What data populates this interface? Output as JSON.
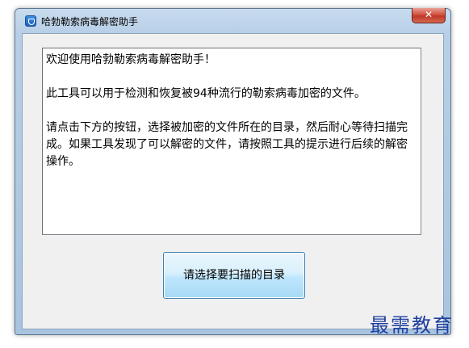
{
  "window": {
    "title": "哈勃勒索病毒解密助手",
    "close_symbol": "✕"
  },
  "message": {
    "line1": "欢迎使用哈勃勒索病毒解密助手！",
    "line2": "此工具可以用于检测和恢复被94种流行的勒索病毒加密的文件。",
    "line3": "请点击下方的按钮，选择被加密的文件所在的目录，然后耐心等待扫描完成。如果工具发现了可以解密的文件，请按照工具的提示进行后续的解密操作。"
  },
  "actions": {
    "scan_button_label": "请选择要扫描的目录"
  },
  "watermark": {
    "text": "最需教育"
  },
  "icons": {
    "app": "shield-app-icon",
    "close": "close-icon"
  },
  "colors": {
    "titlebar": "#b7cfe7",
    "close_button": "#c0382a",
    "button_fill": "#bee6fd",
    "watermark": "#1f3fa0"
  }
}
